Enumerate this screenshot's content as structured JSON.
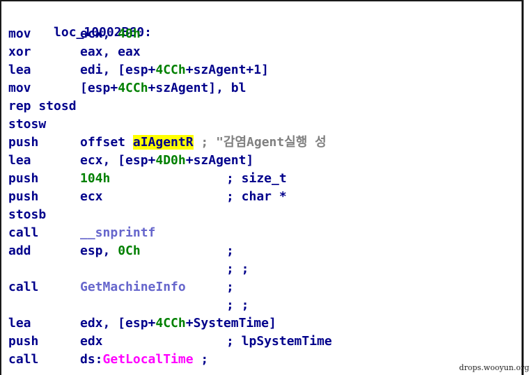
{
  "listing": {
    "label": "loc_10002B60:",
    "lines": [
      {
        "mnemonic": "mov",
        "op1": "ecx, ",
        "imm": "40h"
      },
      {
        "mnemonic": "xor",
        "op1": "eax, eax"
      },
      {
        "mnemonic": "lea",
        "op1": "edi, [esp+",
        "imm": "4CCh",
        "op2": "+szAgent+1]"
      },
      {
        "mnemonic": "mov",
        "op1": "[esp+",
        "imm": "4CCh",
        "op2": "+szAgent], bl"
      },
      {
        "mnemonic": "rep stosd"
      },
      {
        "mnemonic": "stosw"
      },
      {
        "mnemonic": "push",
        "op1": "offset ",
        "highlight": "aIAgentR",
        "comment": " ; \"감염Agent실행 성"
      },
      {
        "mnemonic": "lea",
        "op1": "ecx, [esp+",
        "imm": "4D0h",
        "op2": "+szAgent]"
      },
      {
        "mnemonic": "push",
        "imm": "104h",
        "comment": "; size_t"
      },
      {
        "mnemonic": "push",
        "op1": "ecx",
        "comment": "; char *"
      },
      {
        "mnemonic": "stosb"
      },
      {
        "mnemonic": "call",
        "func": "__snprintf"
      },
      {
        "mnemonic": "add",
        "op1": "esp, ",
        "imm": "0Ch",
        "comment": ";"
      },
      {
        "comment": "; ;"
      },
      {
        "mnemonic": "call",
        "func": "GetMachineInfo",
        "comment": ";"
      },
      {
        "comment": "; ;"
      },
      {
        "mnemonic": "lea",
        "op1": "edx, [esp+",
        "imm": "4CCh",
        "op2": "+SystemTime]"
      },
      {
        "mnemonic": "push",
        "op1": "edx",
        "comment": "; lpSystemTime"
      },
      {
        "mnemonic": "call",
        "op1": "ds:",
        "import": "GetLocalTime",
        "comment": " ;"
      }
    ]
  },
  "watermark": "drops.wooyun.org"
}
